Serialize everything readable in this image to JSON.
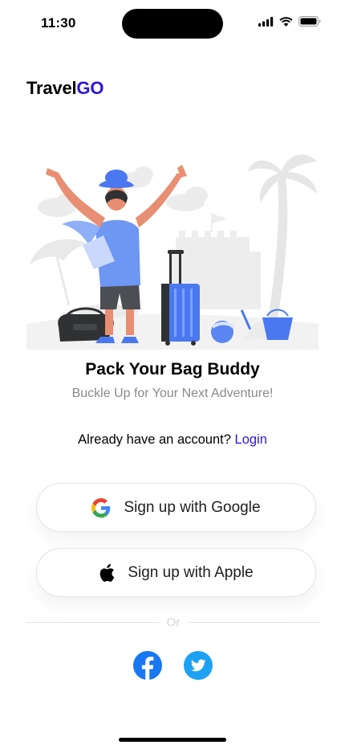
{
  "status_bar": {
    "time": "11:30"
  },
  "brand": {
    "name_prefix": "Travel",
    "name_accent": "GO",
    "accent_color": "#2b16d9"
  },
  "hero": {
    "headline": "Pack Your Bag  Buddy",
    "subline": "Buckle Up for Your Next Adventure!"
  },
  "account": {
    "prompt": "Already have an account?",
    "login_label": "Login"
  },
  "buttons": {
    "google_label": "Sign up with Google",
    "apple_label": "Sign up with Apple"
  },
  "divider": {
    "label": "Or"
  },
  "social_links": [
    "facebook-icon",
    "twitter-icon"
  ],
  "colors": {
    "primary": "#2b16d9",
    "illustration_blue": "#4a78f0",
    "skin": "#e88e72"
  }
}
